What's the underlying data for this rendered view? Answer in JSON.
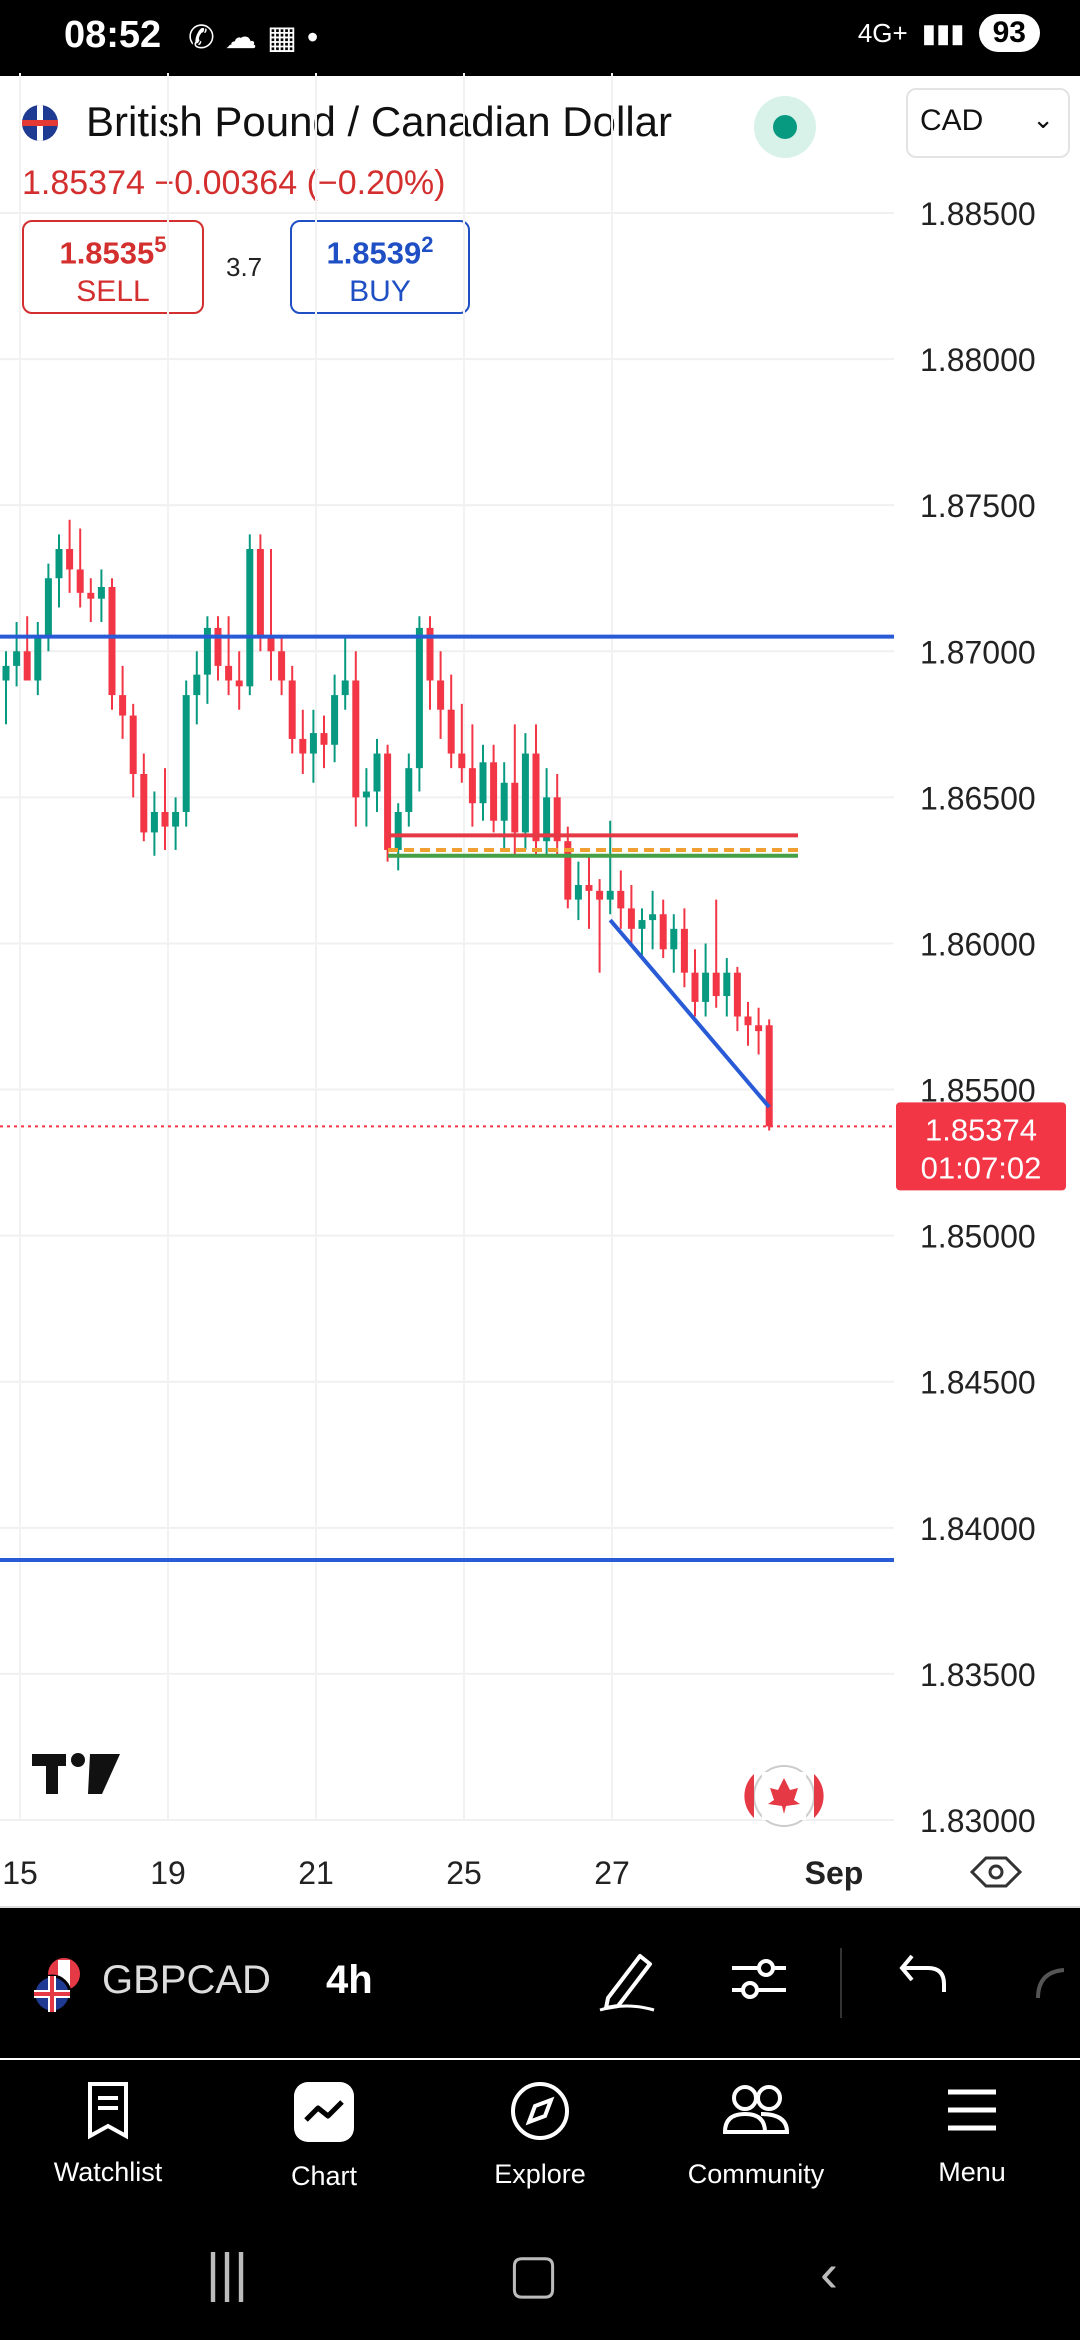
{
  "status_bar": {
    "time": "08:52",
    "battery": "93",
    "network": "4G+"
  },
  "header": {
    "title": "British Pound / Canadian Dollar",
    "currency_select": "CAD",
    "last_price": "1.85374",
    "change": "−0.00364 (−0.20%)",
    "sell": {
      "price_main": "1.8535",
      "price_pip": "5",
      "label": "SELL"
    },
    "buy": {
      "price_main": "1.8539",
      "price_pip": "2",
      "label": "BUY"
    },
    "spread": "3.7"
  },
  "chart_data": {
    "type": "candlestick",
    "symbol": "GBPCAD",
    "interval": "4h",
    "y_ticks": [
      "1.88500",
      "1.88000",
      "1.87500",
      "1.87000",
      "1.86500",
      "1.86000",
      "1.85500",
      "1.85000",
      "1.84500",
      "1.84000",
      "1.83500",
      "1.83000"
    ],
    "y_range": [
      1.83,
      1.885
    ],
    "x_ticks": [
      "15",
      "19",
      "21",
      "25",
      "27",
      "Sep"
    ],
    "current_price_label": "1.85374",
    "countdown": "01:07:02",
    "horizontal_lines": [
      {
        "price": 1.8705,
        "color": "#2a5bd7"
      },
      {
        "price": 1.8389,
        "color": "#2a5bd7"
      },
      {
        "price": 1.8637,
        "color": "#e53945"
      },
      {
        "price": 1.8632,
        "color": "#f0a030"
      },
      {
        "price": 1.863,
        "color": "#43a047"
      }
    ],
    "candles": [
      {
        "o": 1.869,
        "h": 1.87,
        "l": 1.8675,
        "c": 1.8695
      },
      {
        "o": 1.8695,
        "h": 1.871,
        "l": 1.8688,
        "c": 1.87
      },
      {
        "o": 1.87,
        "h": 1.8712,
        "l": 1.869,
        "c": 1.869
      },
      {
        "o": 1.869,
        "h": 1.871,
        "l": 1.8685,
        "c": 1.8705
      },
      {
        "o": 1.8705,
        "h": 1.873,
        "l": 1.87,
        "c": 1.8725
      },
      {
        "o": 1.8725,
        "h": 1.874,
        "l": 1.8715,
        "c": 1.8735
      },
      {
        "o": 1.8735,
        "h": 1.8745,
        "l": 1.872,
        "c": 1.8728
      },
      {
        "o": 1.8728,
        "h": 1.8742,
        "l": 1.8715,
        "c": 1.872
      },
      {
        "o": 1.872,
        "h": 1.8725,
        "l": 1.871,
        "c": 1.8718
      },
      {
        "o": 1.8718,
        "h": 1.8728,
        "l": 1.871,
        "c": 1.8722
      },
      {
        "o": 1.8722,
        "h": 1.8725,
        "l": 1.868,
        "c": 1.8685
      },
      {
        "o": 1.8685,
        "h": 1.8695,
        "l": 1.867,
        "c": 1.8678
      },
      {
        "o": 1.8678,
        "h": 1.8682,
        "l": 1.865,
        "c": 1.8658
      },
      {
        "o": 1.8658,
        "h": 1.8665,
        "l": 1.8635,
        "c": 1.8638
      },
      {
        "o": 1.8638,
        "h": 1.8652,
        "l": 1.863,
        "c": 1.8645
      },
      {
        "o": 1.8645,
        "h": 1.866,
        "l": 1.8632,
        "c": 1.864
      },
      {
        "o": 1.864,
        "h": 1.865,
        "l": 1.8632,
        "c": 1.8645
      },
      {
        "o": 1.8645,
        "h": 1.869,
        "l": 1.864,
        "c": 1.8685
      },
      {
        "o": 1.8685,
        "h": 1.87,
        "l": 1.8675,
        "c": 1.8692
      },
      {
        "o": 1.8692,
        "h": 1.8712,
        "l": 1.8682,
        "c": 1.8708
      },
      {
        "o": 1.8708,
        "h": 1.8712,
        "l": 1.869,
        "c": 1.8695
      },
      {
        "o": 1.8695,
        "h": 1.8712,
        "l": 1.8685,
        "c": 1.869
      },
      {
        "o": 1.869,
        "h": 1.87,
        "l": 1.868,
        "c": 1.8688
      },
      {
        "o": 1.8688,
        "h": 1.874,
        "l": 1.8685,
        "c": 1.8735
      },
      {
        "o": 1.8735,
        "h": 1.874,
        "l": 1.87,
        "c": 1.8705
      },
      {
        "o": 1.8705,
        "h": 1.8735,
        "l": 1.869,
        "c": 1.87
      },
      {
        "o": 1.87,
        "h": 1.8705,
        "l": 1.8685,
        "c": 1.869
      },
      {
        "o": 1.869,
        "h": 1.8695,
        "l": 1.8665,
        "c": 1.867
      },
      {
        "o": 1.867,
        "h": 1.868,
        "l": 1.8658,
        "c": 1.8665
      },
      {
        "o": 1.8665,
        "h": 1.868,
        "l": 1.8655,
        "c": 1.8672
      },
      {
        "o": 1.8672,
        "h": 1.8678,
        "l": 1.866,
        "c": 1.8668
      },
      {
        "o": 1.8668,
        "h": 1.8692,
        "l": 1.8662,
        "c": 1.8685
      },
      {
        "o": 1.8685,
        "h": 1.8705,
        "l": 1.868,
        "c": 1.869
      },
      {
        "o": 1.869,
        "h": 1.87,
        "l": 1.864,
        "c": 1.865
      },
      {
        "o": 1.865,
        "h": 1.866,
        "l": 1.864,
        "c": 1.8652
      },
      {
        "o": 1.8652,
        "h": 1.867,
        "l": 1.8645,
        "c": 1.8665
      },
      {
        "o": 1.8665,
        "h": 1.8668,
        "l": 1.8628,
        "c": 1.8632
      },
      {
        "o": 1.8632,
        "h": 1.8648,
        "l": 1.8625,
        "c": 1.8645
      },
      {
        "o": 1.8645,
        "h": 1.8665,
        "l": 1.864,
        "c": 1.866
      },
      {
        "o": 1.866,
        "h": 1.8712,
        "l": 1.8652,
        "c": 1.8708
      },
      {
        "o": 1.8708,
        "h": 1.8712,
        "l": 1.868,
        "c": 1.869
      },
      {
        "o": 1.869,
        "h": 1.87,
        "l": 1.867,
        "c": 1.868
      },
      {
        "o": 1.868,
        "h": 1.8692,
        "l": 1.866,
        "c": 1.8665
      },
      {
        "o": 1.8665,
        "h": 1.8682,
        "l": 1.8655,
        "c": 1.866
      },
      {
        "o": 1.866,
        "h": 1.8675,
        "l": 1.864,
        "c": 1.8648
      },
      {
        "o": 1.8648,
        "h": 1.8668,
        "l": 1.8642,
        "c": 1.8662
      },
      {
        "o": 1.8662,
        "h": 1.8668,
        "l": 1.8638,
        "c": 1.8642
      },
      {
        "o": 1.8642,
        "h": 1.8662,
        "l": 1.8632,
        "c": 1.8655
      },
      {
        "o": 1.8655,
        "h": 1.8675,
        "l": 1.863,
        "c": 1.8638
      },
      {
        "o": 1.8638,
        "h": 1.8672,
        "l": 1.8632,
        "c": 1.8665
      },
      {
        "o": 1.8665,
        "h": 1.8675,
        "l": 1.863,
        "c": 1.8635
      },
      {
        "o": 1.8635,
        "h": 1.866,
        "l": 1.863,
        "c": 1.865
      },
      {
        "o": 1.865,
        "h": 1.8658,
        "l": 1.863,
        "c": 1.8635
      },
      {
        "o": 1.8635,
        "h": 1.864,
        "l": 1.8612,
        "c": 1.8615
      },
      {
        "o": 1.8615,
        "h": 1.8628,
        "l": 1.8608,
        "c": 1.862
      },
      {
        "o": 1.862,
        "h": 1.863,
        "l": 1.8605,
        "c": 1.8618
      },
      {
        "o": 1.8618,
        "h": 1.8622,
        "l": 1.859,
        "c": 1.8615
      },
      {
        "o": 1.8615,
        "h": 1.8642,
        "l": 1.861,
        "c": 1.8618
      },
      {
        "o": 1.8618,
        "h": 1.8625,
        "l": 1.8605,
        "c": 1.8612
      },
      {
        "o": 1.8612,
        "h": 1.862,
        "l": 1.86,
        "c": 1.8605
      },
      {
        "o": 1.8605,
        "h": 1.8612,
        "l": 1.8595,
        "c": 1.8608
      },
      {
        "o": 1.8608,
        "h": 1.8618,
        "l": 1.8598,
        "c": 1.861
      },
      {
        "o": 1.861,
        "h": 1.8615,
        "l": 1.8595,
        "c": 1.8598
      },
      {
        "o": 1.8598,
        "h": 1.861,
        "l": 1.859,
        "c": 1.8605
      },
      {
        "o": 1.8605,
        "h": 1.8612,
        "l": 1.8585,
        "c": 1.859
      },
      {
        "o": 1.859,
        "h": 1.8598,
        "l": 1.8575,
        "c": 1.858
      },
      {
        "o": 1.858,
        "h": 1.86,
        "l": 1.8575,
        "c": 1.859
      },
      {
        "o": 1.859,
        "h": 1.8615,
        "l": 1.8578,
        "c": 1.8582
      },
      {
        "o": 1.8582,
        "h": 1.8595,
        "l": 1.8575,
        "c": 1.859
      },
      {
        "o": 1.859,
        "h": 1.8592,
        "l": 1.857,
        "c": 1.8575
      },
      {
        "o": 1.8575,
        "h": 1.858,
        "l": 1.8565,
        "c": 1.8572
      },
      {
        "o": 1.8572,
        "h": 1.8578,
        "l": 1.8562,
        "c": 1.857
      },
      {
        "o": 1.8572,
        "h": 1.8574,
        "l": 1.8536,
        "c": 1.85374
      }
    ],
    "trend_line": {
      "from": {
        "index": 57,
        "price": 1.8608
      },
      "to": {
        "index": 72,
        "price": 1.8544
      },
      "color": "#2a5bd7"
    }
  },
  "toolbar": {
    "symbol": "GBPCAD",
    "timeframe": "4h"
  },
  "nav": [
    {
      "label": "Watchlist",
      "icon": "watchlist-icon"
    },
    {
      "label": "Chart",
      "icon": "chart-icon"
    },
    {
      "label": "Explore",
      "icon": "compass-icon"
    },
    {
      "label": "Community",
      "icon": "community-icon"
    },
    {
      "label": "Menu",
      "icon": "menu-icon"
    }
  ]
}
